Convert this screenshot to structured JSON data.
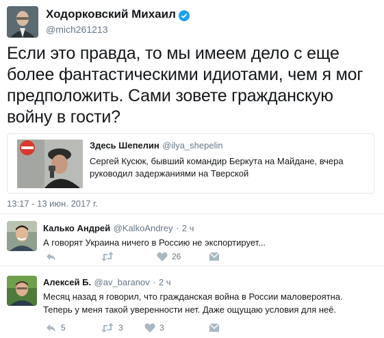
{
  "main_tweet": {
    "author_name": "Ходорковский Михаил",
    "author_handle": "@mich261213",
    "verified_icon": "verified-badge-icon",
    "text": "Если это правда, то мы имеем дело с еще более фантастическими идиотами, чем я мог предположить. Сами зовете гражданскую войну в гости?",
    "timestamp": "13:17 - 13 июн. 2017 г."
  },
  "quoted_tweet": {
    "author_name": "Здесь Шепелин",
    "author_handle": "@ilya_shepelin",
    "text": "Сергей Кусюк, бывший командир Беркута на Майдане, вчера руководил задержаниями на Тверской"
  },
  "replies": [
    {
      "author_name": "Калько Андрей",
      "author_handle": "@KalkoAndrey",
      "separator": "·",
      "time": "2 ч",
      "text": "А говорят Украина ничего в Россию не экспортирует...",
      "reply_count": "",
      "retweet_count": "",
      "like_count": "26"
    },
    {
      "author_name": "Алексей Б.",
      "author_handle": "@av_baranov",
      "separator": "·",
      "time": "2 ч",
      "text": "Месяц назад я говорил, что гражданская война в России маловероятна. Теперь у меня такой уверенности нет. Даже ощущаю условия для неё.",
      "reply_count": "5",
      "retweet_count": "3",
      "like_count": "3"
    }
  ],
  "icons": [
    "reply-icon",
    "retweet-icon",
    "like-icon",
    "dm-icon"
  ],
  "colors": {
    "verified": "#1da1f2",
    "muted": "#657786",
    "text": "#14171a",
    "border": "#e1e8ed"
  }
}
